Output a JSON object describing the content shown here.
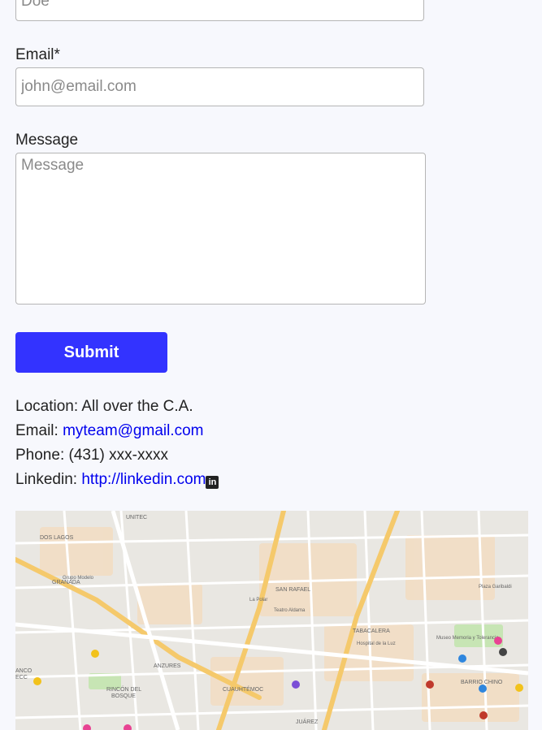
{
  "form": {
    "last_name": {
      "placeholder": "Doe"
    },
    "email": {
      "label": "Email*",
      "placeholder": "john@email.com"
    },
    "message": {
      "label": "Message",
      "placeholder": "Message"
    },
    "submit_label": "Submit"
  },
  "contact": {
    "location_label": "Location:",
    "location_value": "All over the C.A.",
    "email_label": "Email:",
    "email_value": "myteam@gmail.com",
    "phone_label": "Phone:",
    "phone_value": "(431) xxx-xxxx",
    "linkedin_label": "Linkedin:",
    "linkedin_value": "http://linkedin.com",
    "linkedin_icon": "linkedin-icon"
  },
  "map": {
    "labels": {
      "unitec": "UNITEC",
      "dos_lagos": "DOS LAGOS",
      "granada": "GRANADA",
      "anzures": "ANZURES",
      "rincon": "RINCÓN DEL",
      "bosque": "BOSQUE",
      "cuauhtemoc": "CUAUHTÉMOC",
      "san_rafael": "SAN RAFAEL",
      "tabacalera": "TABACALERA",
      "barrio_chino": "BARRIO CHINO",
      "juarez": "JUÁREZ",
      "plaza_garibaldi": "Plaza Garibaldi",
      "la_polar": "La Polar",
      "teatro": "Teatro Aldama",
      "hospital": "Hospital de la Luz",
      "museo": "Museo Memoria y Tolerancia",
      "grupo_modelo": "Grupo Modelo",
      "ancho": "ANCO",
      "ecc": "ECC"
    },
    "colors": {
      "road_major": "#f5c96b",
      "road": "#ffffff",
      "block": "#e9e7e2",
      "block_warm": "#f3dcc0",
      "park": "#c7e5b4",
      "pin_red": "#c0392b",
      "pin_yellow": "#f2c21b",
      "pin_blue": "#2e86de",
      "pin_purple": "#7b4fd6",
      "pin_pink": "#e84393"
    }
  }
}
